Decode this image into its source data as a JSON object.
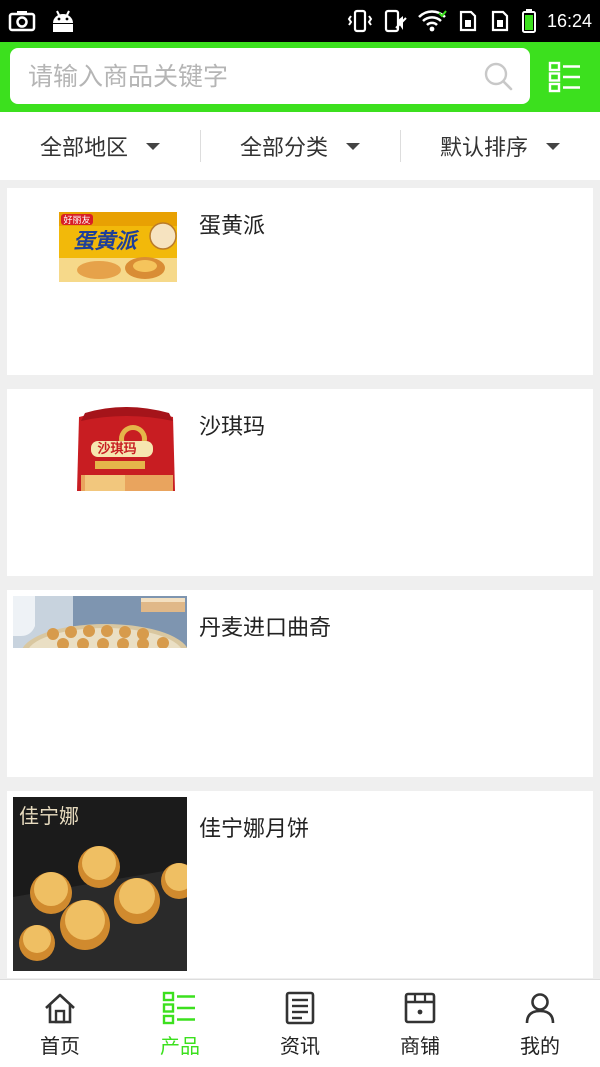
{
  "status_bar": {
    "time": "16:24",
    "icons": [
      "screenshot-icon",
      "android-icon",
      "vibrate-icon",
      "mute-icon",
      "wifi-icon",
      "sim1-icon",
      "sim2-icon",
      "battery-icon"
    ]
  },
  "search": {
    "placeholder": "请输入商品关键字",
    "value": ""
  },
  "filters": [
    {
      "label": "全部地区"
    },
    {
      "label": "全部分类"
    },
    {
      "label": "默认排序"
    }
  ],
  "products": [
    {
      "title": "蛋黄派",
      "image_text": "蛋黄派",
      "brand_text": "好丽友"
    },
    {
      "title": "沙琪玛",
      "image_text": "沙琪玛"
    },
    {
      "title": "丹麦进口曲奇"
    },
    {
      "title": "佳宁娜月饼",
      "image_text": "佳宁娜"
    }
  ],
  "bottom_nav": {
    "active_index": 1,
    "items": [
      {
        "label": "首页",
        "icon": "home-icon"
      },
      {
        "label": "产品",
        "icon": "products-icon"
      },
      {
        "label": "资讯",
        "icon": "news-icon"
      },
      {
        "label": "商铺",
        "icon": "shop-icon"
      },
      {
        "label": "我的",
        "icon": "profile-icon"
      }
    ]
  },
  "colors": {
    "brand_green": "#3ce01e",
    "status_bar": "#000000",
    "page_bg": "#efefef"
  }
}
